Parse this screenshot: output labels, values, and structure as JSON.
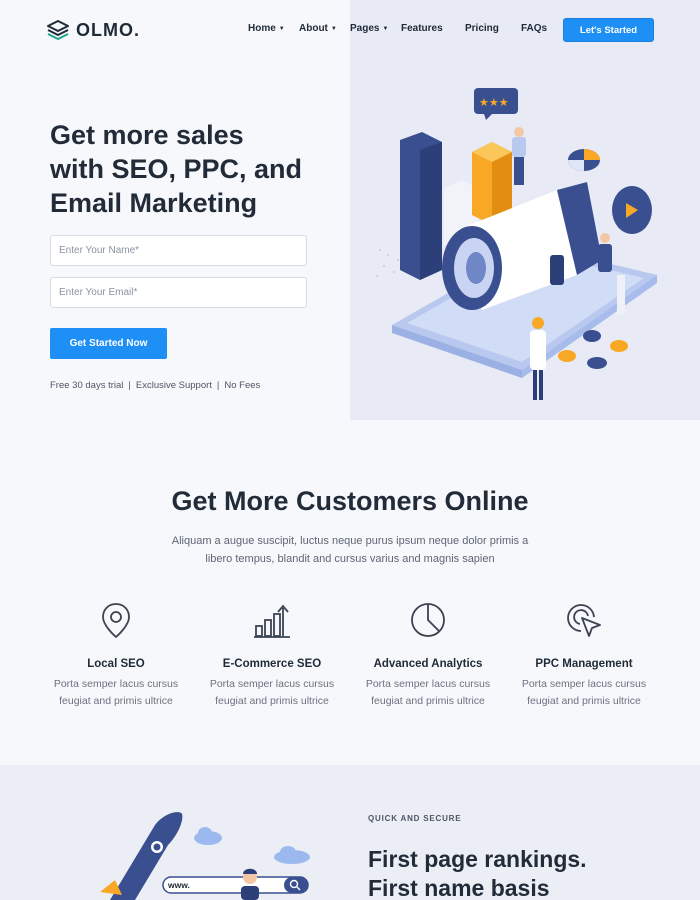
{
  "brand": {
    "name": "OLMO."
  },
  "nav": {
    "items": [
      {
        "label": "Home",
        "has_dropdown": true
      },
      {
        "label": "About",
        "has_dropdown": true
      },
      {
        "label": "Pages",
        "has_dropdown": true
      },
      {
        "label": "Features",
        "has_dropdown": false
      },
      {
        "label": "Pricing",
        "has_dropdown": false
      },
      {
        "label": "FAQs",
        "has_dropdown": false
      }
    ],
    "cta_label": "Let's Started"
  },
  "hero": {
    "title_lines": [
      "Get more sales",
      "with SEO, PPC, and",
      "Email Marketing"
    ],
    "name_placeholder": "Enter Your Name*",
    "email_placeholder": "Enter Your Email*",
    "submit_label": "Get Started Now",
    "perks": [
      "Free 30 days trial",
      "Exclusive Support",
      "No Fees"
    ]
  },
  "features_section": {
    "title": "Get More Customers Online",
    "subtitle": "Aliquam a augue suscipit, luctus neque purus ipsum neque dolor primis a libero tempus, blandit and cursus varius and magnis sapien",
    "items": [
      {
        "icon": "location-pin-icon",
        "title": "Local SEO",
        "desc": "Porta semper lacus cursus feugiat and primis ultrice"
      },
      {
        "icon": "bar-chart-growth-icon",
        "title": "E-Commerce SEO",
        "desc": "Porta semper lacus cursus feugiat and primis ultrice"
      },
      {
        "icon": "pie-chart-icon",
        "title": "Advanced Analytics",
        "desc": "Porta semper lacus cursus feugiat and primis ultrice"
      },
      {
        "icon": "cursor-target-icon",
        "title": "PPC Management",
        "desc": "Porta semper lacus cursus feugiat and primis ultrice"
      }
    ]
  },
  "ranking_section": {
    "eyebrow": "QUICK AND SECURE",
    "title_lines": [
      "First page rankings.",
      "First name basis"
    ],
    "search_text": "www."
  },
  "colors": {
    "accent": "#1e8ff5",
    "dark_text": "#222b38",
    "hero_right_bg": "#e8ebf5",
    "illustration_navy": "#3a4f8f",
    "illustration_orange": "#f9a825"
  }
}
